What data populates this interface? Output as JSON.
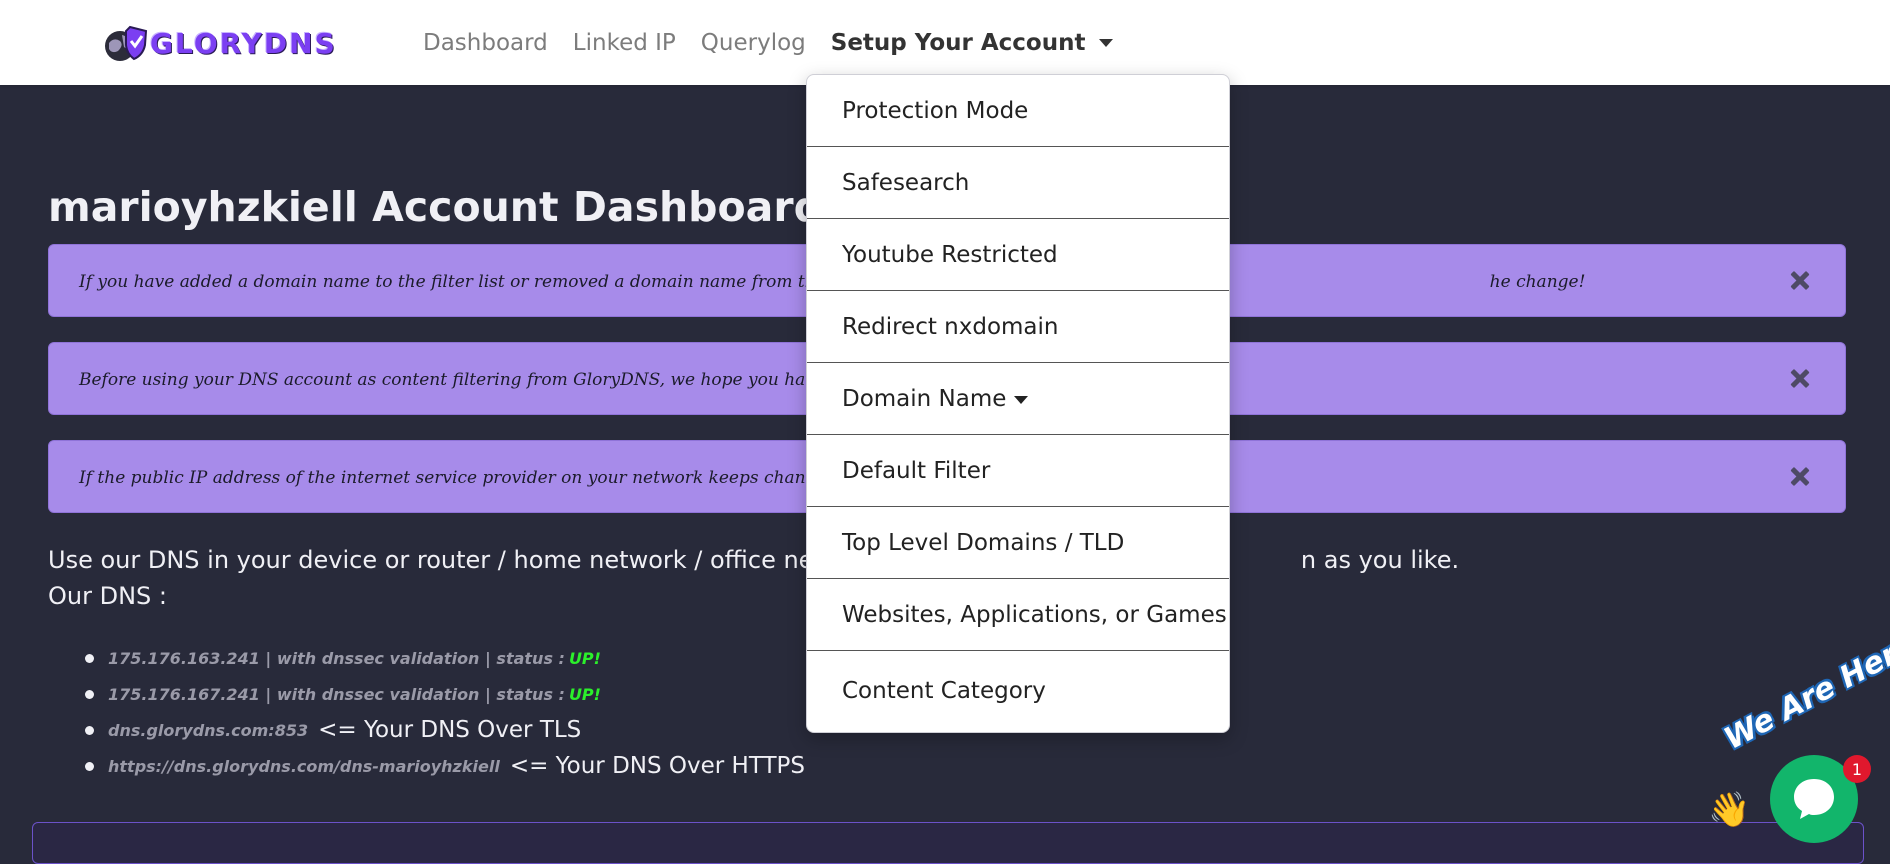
{
  "brand": {
    "name": "GLORYDNS",
    "accent": "#7b3ff2"
  },
  "nav": {
    "links": [
      "Dashboard",
      "Linked IP",
      "Querylog"
    ],
    "active": "Setup Your Account"
  },
  "dropdown": {
    "items": [
      "Protection Mode",
      "Safesearch",
      "Youtube Restricted",
      "Redirect nxdomain",
      "Domain Name",
      "Default Filter",
      "Top Level Domains / TLD",
      "Websites, Applications, or Games",
      "Content Category"
    ]
  },
  "page": {
    "title": "marioyhzkiell Account Dashboard"
  },
  "alerts": [
    {
      "left": "If you have added a domain name to the filter list or removed a domain name from the filter list, disab",
      "right": "he change!"
    },
    {
      "left": "Before using your DNS account as content filtering from GloryDNS, we hope you have linked your publ",
      "right": ""
    },
    {
      "left": "If the public IP address of the internet service provider on your network keeps changing, please relink y",
      "right": ""
    }
  ],
  "usage": {
    "line1_left": "Use our DNS in your device or router / home network / office network, a",
    "line1_right": "n as you like.",
    "line2": "Our DNS :"
  },
  "dns": {
    "servers": [
      {
        "text": "175.176.163.241 | with dnssec validation | status :",
        "status": "UP!"
      },
      {
        "text": "175.176.167.241 | with dnssec validation | status :",
        "status": "UP!"
      }
    ],
    "tls": {
      "addr": "dns.glorydns.com:853",
      "desc": "<= Your DNS Over TLS"
    },
    "https": {
      "addr": "https://dns.glorydns.com/dns-marioyhzkiell",
      "desc": "<= Your DNS Over HTTPS"
    }
  },
  "chat": {
    "banner": "We Are Here!",
    "badge": "1",
    "color": "#12b56b"
  },
  "colors": {
    "background": "#282a3a",
    "alert": "#a78bea",
    "status_up": "#2bf02b"
  }
}
